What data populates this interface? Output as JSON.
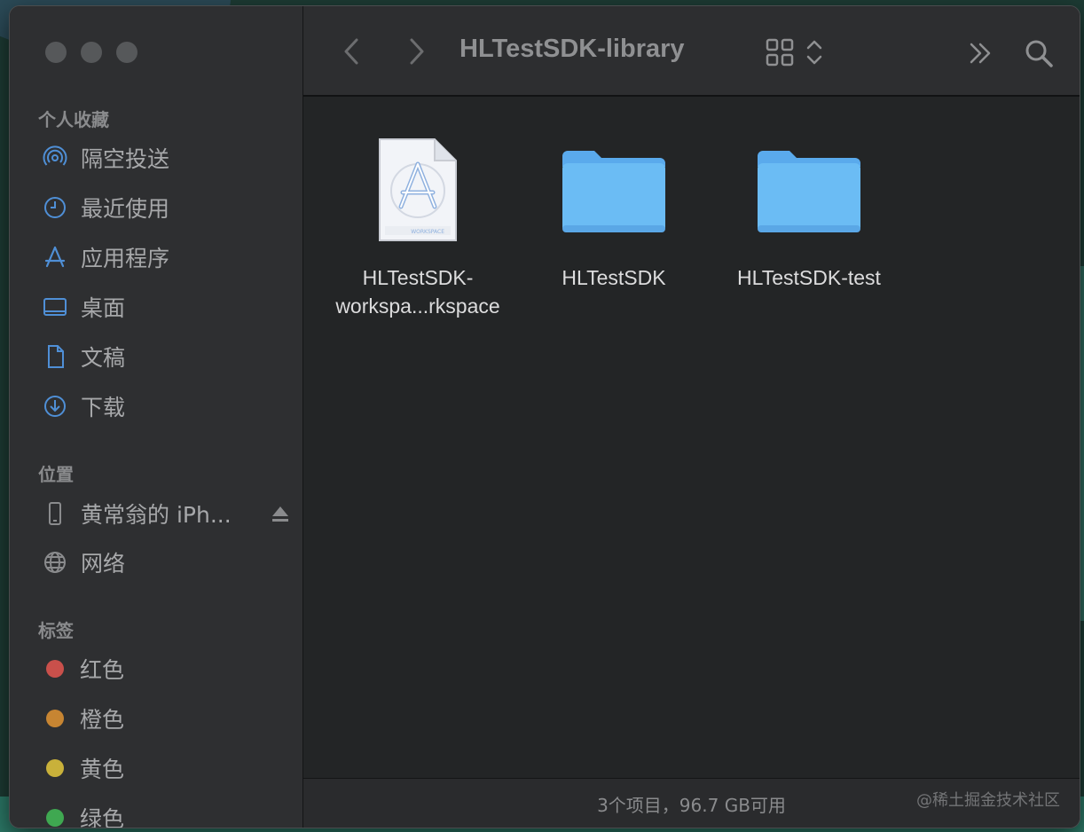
{
  "window": {
    "title": "HLTestSDK-library"
  },
  "sidebar": {
    "favorites_title": "个人收藏",
    "favorites": [
      {
        "label": "隔空投送",
        "icon": "airdrop-icon"
      },
      {
        "label": "最近使用",
        "icon": "clock-icon"
      },
      {
        "label": "应用程序",
        "icon": "applications-icon"
      },
      {
        "label": "桌面",
        "icon": "desktop-icon"
      },
      {
        "label": "文稿",
        "icon": "document-icon"
      },
      {
        "label": "下载",
        "icon": "download-icon"
      }
    ],
    "locations_title": "位置",
    "locations": [
      {
        "label": "黄常翁的 iPh...",
        "icon": "iphone-icon"
      },
      {
        "label": "网络",
        "icon": "globe-icon"
      }
    ],
    "tags_title": "标签",
    "tags": [
      {
        "label": "红色",
        "color": "#c9504b"
      },
      {
        "label": "橙色",
        "color": "#c78532"
      },
      {
        "label": "黄色",
        "color": "#c9b13a"
      },
      {
        "label": "绿色",
        "color": "#3fa851"
      }
    ]
  },
  "toolbar": {
    "back_icon": "chevron-left-icon",
    "forward_icon": "chevron-right-icon",
    "view_icon": "grid-view-icon",
    "more_icon": "double-chevron-right-icon",
    "search_icon": "search-icon"
  },
  "files": [
    {
      "name_line1": "HLTestSDK-",
      "name_line2": "workspa...rkspace",
      "kind": "workspace",
      "badge": "WORKSPACE"
    },
    {
      "name_line1": "HLTestSDK",
      "name_line2": "",
      "kind": "folder"
    },
    {
      "name_line1": "HLTestSDK-test",
      "name_line2": "",
      "kind": "folder"
    }
  ],
  "status": {
    "text": "3个项目，96.7 GB可用",
    "watermark": "@稀土掘金技术社区"
  }
}
